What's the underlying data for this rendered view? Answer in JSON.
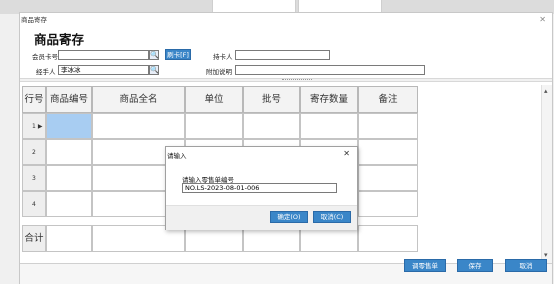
{
  "window": {
    "title": "商品寄存",
    "close_icon": "close-icon"
  },
  "form": {
    "heading": "商品寄存",
    "member_card_label": "会员卡号",
    "member_card_value": "",
    "swipe_button": "刷卡[F]",
    "cardholder_label": "持卡人",
    "cardholder_value": "",
    "handler_label": "经手人",
    "handler_value": "李冰冰",
    "note_label": "附加说明",
    "note_value": ""
  },
  "grid": {
    "columns": [
      "行号",
      "商品编号",
      "商品全名",
      "单位",
      "批号",
      "寄存数量",
      "备注"
    ],
    "rows": [
      {
        "no": "1",
        "current": true
      },
      {
        "no": "2",
        "current": false
      },
      {
        "no": "3",
        "current": false
      },
      {
        "no": "4",
        "current": false
      }
    ],
    "total_label": "合计"
  },
  "footer": {
    "retail_button": "调零售单",
    "save_button": "保存",
    "cancel_button": "取消"
  },
  "dialog": {
    "title": "请输入",
    "prompt": "请输入零售单编号",
    "input_value": "NO.LS-2023-08-01-006",
    "ok_button": "确定(O)",
    "cancel_button": "取消(C)"
  },
  "colors": {
    "accent": "#3a86c8",
    "selected_cell": "#a8cdf2"
  }
}
